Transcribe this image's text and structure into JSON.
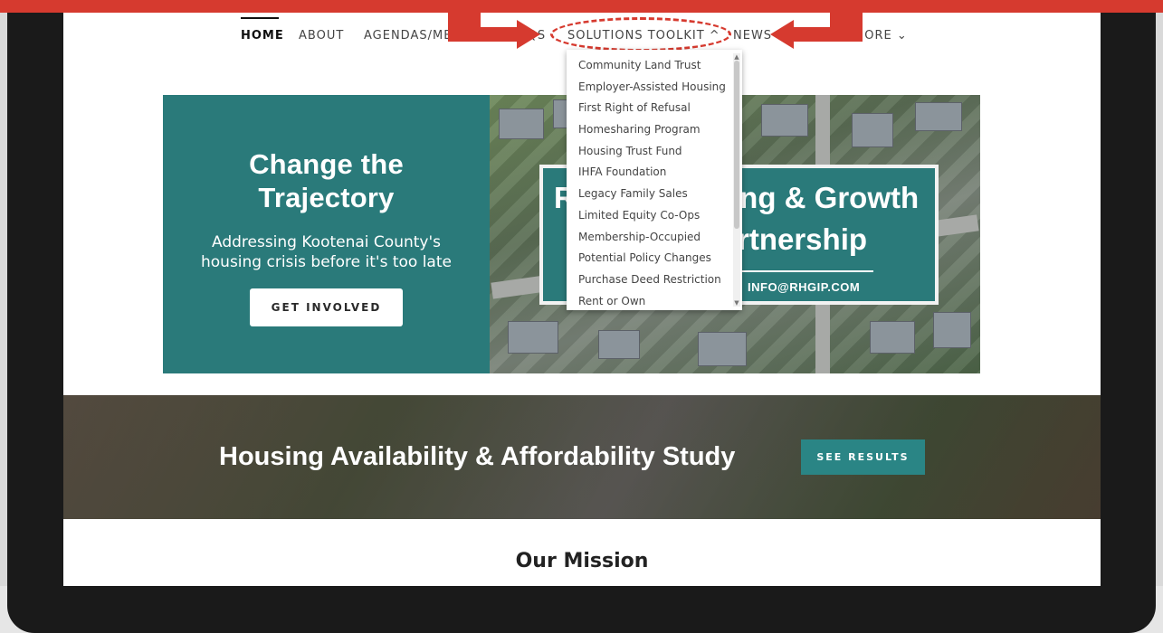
{
  "nav": {
    "items": [
      {
        "label": "HOME"
      },
      {
        "label": "ABOUT"
      },
      {
        "label": "AGENDAS/ME"
      },
      {
        "label": "AQS"
      },
      {
        "label": "SOLUTIONS TOOLKIT ^"
      },
      {
        "label": "NEWS"
      },
      {
        "label": "MORE ⌄"
      }
    ]
  },
  "dropdown": {
    "items": [
      "Community Land Trust",
      "Employer-Assisted Housing",
      "First Right of Refusal",
      "Homesharing Program",
      "Housing Trust Fund",
      "IHFA Foundation",
      "Legacy Family Sales",
      "Limited Equity Co-Ops",
      "Membership-Occupied",
      "Potential Policy Changes",
      "Purchase Deed Restriction",
      "Rent or Own"
    ]
  },
  "hero": {
    "title": "Change the Trajectory",
    "subtitle": "Addressing Kootenai County's housing crisis before it's too late",
    "button": "GET INVOLVED",
    "sign_line1_left": "R",
    "sign_line1_right": "ing & Growth",
    "sign_line2": "rtnership",
    "sign_email": "INFO@RHGIP.COM"
  },
  "study": {
    "title": "Housing Availability & Affordability Study",
    "button": "SEE RESULTS"
  },
  "mission": {
    "title": "Our Mission"
  },
  "colors": {
    "teal": "#2a7a7a",
    "annotation_red": "#d63a2f"
  }
}
